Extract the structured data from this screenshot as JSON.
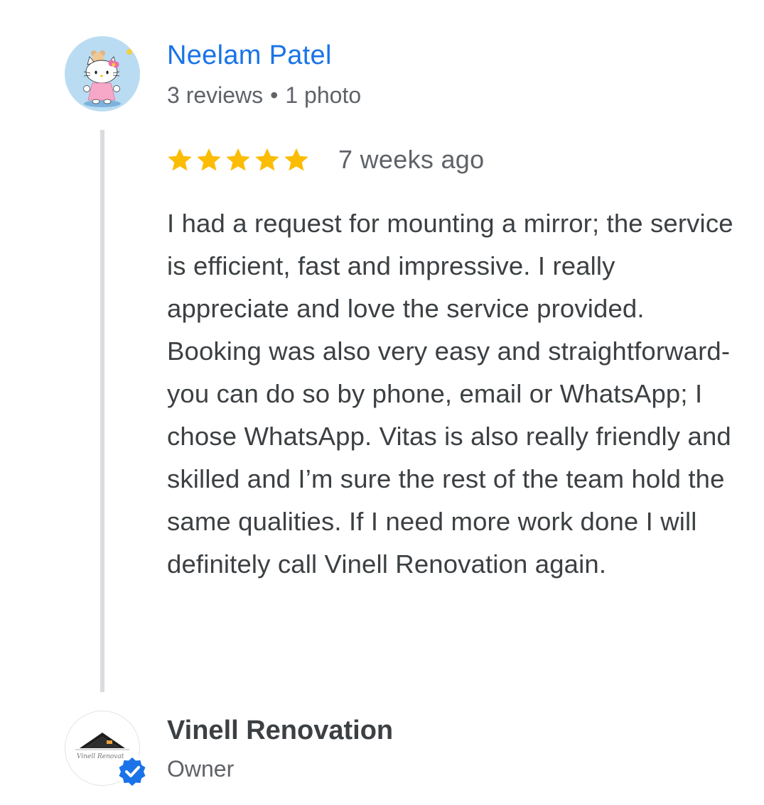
{
  "review": {
    "reviewer_name": "Neelam Patel",
    "reviews_count": "3 reviews",
    "separator": "•",
    "photos_count": "1 photo",
    "rating": 5,
    "rating_max": 5,
    "date": "7 weeks ago",
    "text": "I had a request for mounting a mirror; the service is efficient, fast and impressive. I really appreciate and love the service provided. Booking was also very easy and straightforward- you can do so by phone, email or WhatsApp; I chose WhatsApp. Vitas is also really friendly and skilled and I’m sure the rest of the team hold the same qualities. If I need more work done I will definitely call Vinell Renovation again."
  },
  "owner": {
    "name": "Vinell Renovation",
    "role": "Owner",
    "logo_text": "Vinell Renovat",
    "verified": true
  },
  "icons": {
    "reviewer_avatar": "hello-kitty-avatar-icon",
    "star": "star-icon",
    "owner_logo": "house-roof-logo-icon",
    "verified": "verified-check-icon"
  },
  "colors": {
    "name_link": "#1a73e8",
    "star": "#fbbc04",
    "secondary_text": "#5f6368",
    "body_text": "#3c4043",
    "thread_line": "#dadce0",
    "verified_badge": "#1a73e8"
  }
}
